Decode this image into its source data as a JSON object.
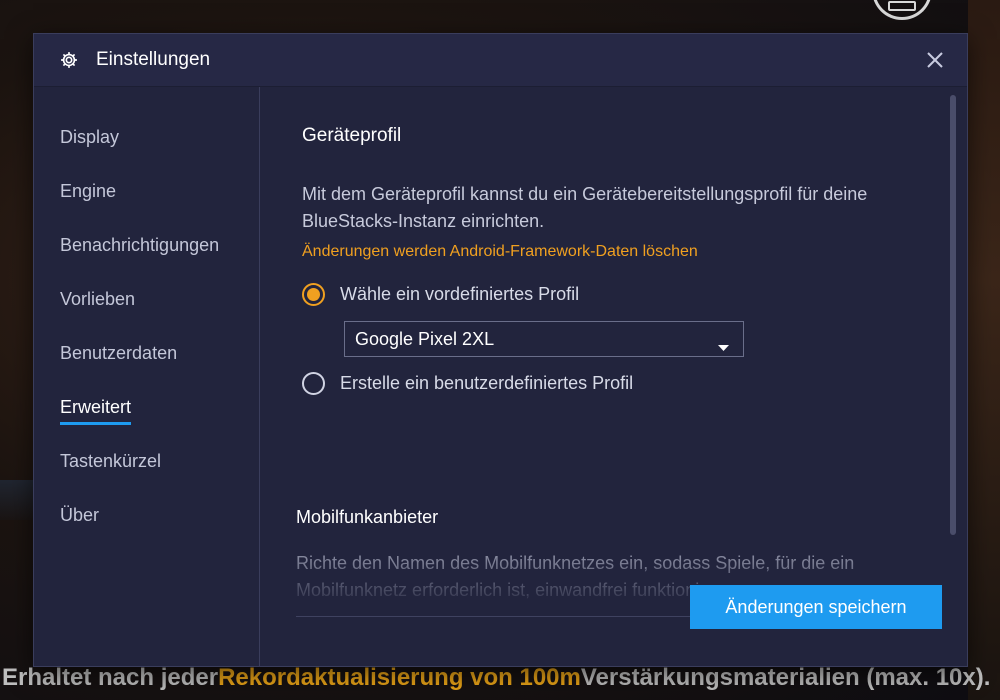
{
  "background": {
    "banner_parts": [
      {
        "text": "Erhaltet nach jeder ",
        "style": "w"
      },
      {
        "text": "Rekordaktualisierung von 100m",
        "style": "o"
      },
      {
        "text": " Verstärkungsmaterialien (max. 10x).",
        "style": "w"
      }
    ]
  },
  "dialog": {
    "title": "Einstellungen",
    "sidebar": {
      "items": [
        {
          "label": "Display",
          "active": false
        },
        {
          "label": "Engine",
          "active": false
        },
        {
          "label": "Benachrichtigungen",
          "active": false
        },
        {
          "label": "Vorlieben",
          "active": false
        },
        {
          "label": "Benutzerdaten",
          "active": false
        },
        {
          "label": "Erweitert",
          "active": true
        },
        {
          "label": "Tastenkürzel",
          "active": false
        },
        {
          "label": "Über",
          "active": false
        }
      ]
    },
    "device_profile": {
      "title": "Geräteprofil",
      "description": "Mit dem Geräteprofil kannst du ein Gerätebereitstellungsprofil für deine BlueStacks-Instanz einrichten.",
      "warning": "Änderungen werden Android-Framework-Daten löschen",
      "option_predefined": "Wähle ein vordefiniertes Profil",
      "selected_profile": "Google Pixel 2XL",
      "option_custom": "Erstelle ein benutzerdefiniertes Profil",
      "selected_option": "predefined"
    },
    "carrier": {
      "title": "Mobilfunkanbieter",
      "description": "Richte den Namen des Mobilfunknetzes ein, sodass Spiele, für die ein Mobilfunknetz erforderlich ist, einwandfrei funktionieren"
    },
    "save_label": "Änderungen speichern"
  },
  "colors": {
    "accent_blue": "#1e9bf0",
    "warning_orange": "#f0a020",
    "dialog_bg": "#22243d"
  }
}
